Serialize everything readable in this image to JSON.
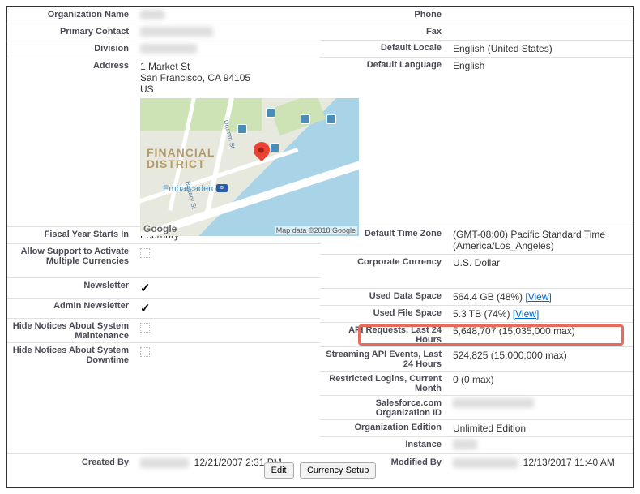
{
  "left": {
    "org_name_label": "Organization Name",
    "primary_contact_label": "Primary Contact",
    "division_label": "Division",
    "address_label": "Address",
    "address_line1": "1 Market St",
    "address_line2": "San Francisco, CA 94105",
    "address_line3": "US",
    "fiscal_label": "Fiscal Year Starts In",
    "fiscal_value": "February",
    "allow_support_label": "Allow Support to Activate Multiple Currencies",
    "newsletter_label": "Newsletter",
    "admin_newsletter_label": "Admin Newsletter",
    "hide_maint_label": "Hide Notices About System Maintenance",
    "hide_down_label": "Hide Notices About System Downtime"
  },
  "right": {
    "phone_label": "Phone",
    "fax_label": "Fax",
    "locale_label": "Default Locale",
    "locale_value": "English (United States)",
    "lang_label": "Default Language",
    "lang_value": "English",
    "tz_label": "Default Time Zone",
    "tz_value": "(GMT-08:00) Pacific Standard Time (America/Los_Angeles)",
    "currency_label": "Corporate Currency",
    "currency_value": "U.S. Dollar",
    "data_space_label": "Used Data Space",
    "data_space_value": "564.4 GB (48%) ",
    "file_space_label": "Used File Space",
    "file_space_value": "5.3 TB (74%) ",
    "api_label": "API Requests, Last 24 Hours",
    "api_value": "5,648,707 (15,035,000 max)",
    "stream_label": "Streaming API Events, Last 24 Hours",
    "stream_value": "524,825 (15,000,000 max)",
    "restricted_label": "Restricted Logins, Current Month",
    "restricted_value": "0 (0 max)",
    "orgid_label": "Salesforce.com Organization ID",
    "edition_label": "Organization Edition",
    "edition_value": "Unlimited Edition",
    "instance_label": "Instance",
    "view_link": "[View]"
  },
  "footer": {
    "created_label": "Created By",
    "created_date": "12/21/2007 2:31 PM",
    "modified_label": "Modified By",
    "modified_date": "12/13/2017 11:40 AM",
    "edit_btn": "Edit",
    "currency_btn": "Currency Setup"
  },
  "map": {
    "district": "FINANCIAL\nDISTRICT",
    "embarcadero": "Embarcadero",
    "google": "Google",
    "attrib": "Map data ©2018 Google"
  }
}
